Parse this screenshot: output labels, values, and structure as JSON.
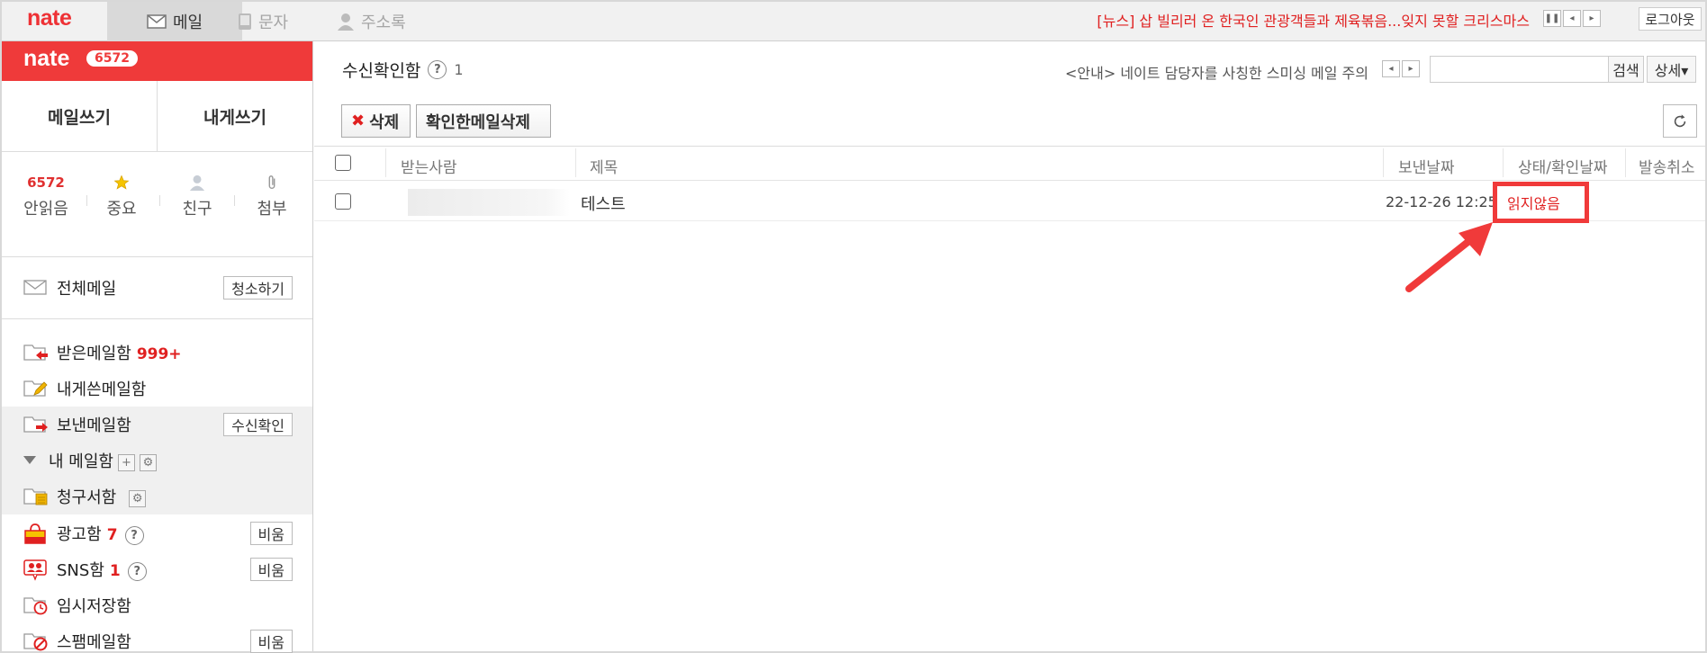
{
  "topbar": {
    "logo": "nate",
    "tabs": [
      {
        "label": "메일",
        "icon": "mail-icon",
        "active": true
      },
      {
        "label": "문자",
        "icon": "phone-icon",
        "active": false
      },
      {
        "label": "주소록",
        "icon": "person-icon",
        "active": false
      }
    ],
    "news": "[뉴스] 삽 빌리러 온 한국인 관광객들과 제육볶음...잊지 못할 크리스마스",
    "logout": "로그아웃"
  },
  "sidebar": {
    "logo": "nate",
    "unread_badge": "6572",
    "compose_label": "메일쓰기",
    "self_compose_label": "내게쓰기",
    "quick": [
      {
        "top": "6572",
        "label": "안읽음"
      },
      {
        "top": "star-icon",
        "label": "중요"
      },
      {
        "top": "friend-icon",
        "label": "친구"
      },
      {
        "top": "clip-icon",
        "label": "첨부"
      }
    ],
    "all_mail": "전체메일",
    "clean_btn": "청소하기",
    "inbox": "받은메일함",
    "inbox_count": "999+",
    "self_box": "내게쓴메일함",
    "sent_box": "보낸메일함",
    "read_check_btn": "수신확인",
    "my_boxes": "내 메일함",
    "bill_box": "청구서함",
    "ad_box": "광고함",
    "ad_count": "7",
    "sns_box": "SNS함",
    "sns_count": "1",
    "draft_box": "임시저장함",
    "spam_box": "스팸메일함",
    "empty_btn": "비움"
  },
  "main": {
    "title": "수신확인함",
    "count": "1",
    "notice": "<안내> 네이트 담당자를 사칭한 스미싱 메일 주의",
    "search_placeholder": "",
    "search_btn": "검색",
    "detail_btn": "상세▾",
    "delete_btn": "삭제",
    "delete_read_btn": "확인한메일삭제",
    "columns": [
      "받는사람",
      "제목",
      "보낸날짜",
      "상태/확인날짜",
      "발송취소"
    ],
    "rows": [
      {
        "recipient": "",
        "subject": "테스트",
        "date": "22-12-26 12:25",
        "status": "읽지않음"
      }
    ]
  },
  "colors": {
    "brand": "#ef3a3a",
    "alert": "#e02020",
    "highlight": "#f03a3a"
  }
}
